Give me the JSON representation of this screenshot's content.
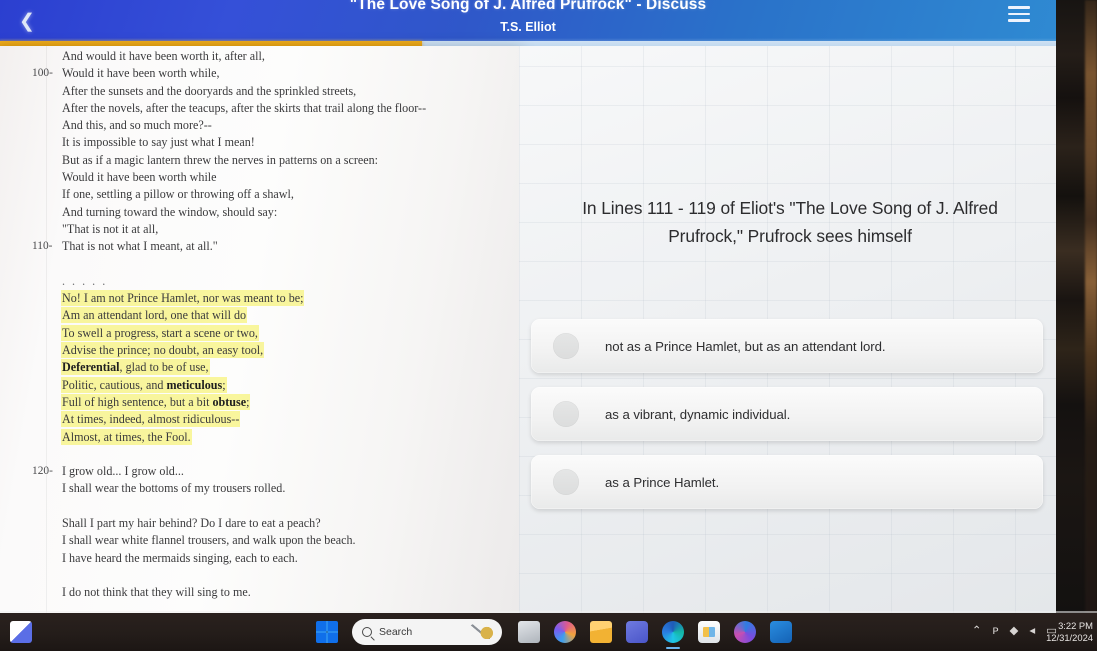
{
  "header": {
    "back_icon": "chevron-left-icon",
    "title": "\"The Love Song of J. Alfred Prufrock\" - Discuss",
    "subtitle": "T.S. Elliot",
    "menu_icon": "hamburger-menu-icon",
    "progress_percent": 40,
    "accent_color": "#e09c10",
    "header_color": "#2f57c9"
  },
  "poem": {
    "lines": [
      {
        "num": "",
        "text": "And would it have been worth it, after all,"
      },
      {
        "num": "100-",
        "text": "Would it have been worth while,"
      },
      {
        "num": "",
        "text": "After the sunsets and the dooryards and the sprinkled streets,"
      },
      {
        "num": "",
        "text": "After the novels, after the teacups, after the skirts that trail along the floor--"
      },
      {
        "num": "",
        "text": "And this, and so much more?--"
      },
      {
        "num": "",
        "text": "It is impossible to say just what I mean!"
      },
      {
        "num": "",
        "text": "But as if a magic lantern threw the nerves in patterns on a screen:"
      },
      {
        "num": "",
        "text": "Would it have been worth while"
      },
      {
        "num": "",
        "text": "If one, settling a pillow or throwing off a shawl,"
      },
      {
        "num": "",
        "text": "And turning toward the window, should say:"
      },
      {
        "num": "",
        "text": "\"That is not it at all,"
      },
      {
        "num": "110-",
        "text": "That is not what I meant, at all.\""
      },
      {
        "num": "",
        "text": "",
        "blank": true
      },
      {
        "num": "",
        "text": ". . . . .",
        "dots": true
      },
      {
        "num": "",
        "text": "No! I am not Prince Hamlet, nor was meant to be;",
        "highlight": true
      },
      {
        "num": "",
        "text": "Am an attendant lord, one that will do",
        "highlight": true
      },
      {
        "num": "",
        "text": "To swell a progress, start a scene or two,",
        "highlight": true
      },
      {
        "num": "",
        "text": "Advise the prince; no doubt, an easy tool,",
        "highlight": true
      },
      {
        "num": "",
        "text": "Deferential, glad to be of use,",
        "highlight": true,
        "bold": "Deferential"
      },
      {
        "num": "",
        "text": "Politic, cautious, and meticulous;",
        "highlight": true,
        "bold": "meticulous"
      },
      {
        "num": "",
        "text": "Full of high sentence, but a bit obtuse;",
        "highlight": true,
        "bold": "obtuse"
      },
      {
        "num": "",
        "text": "At times, indeed, almost ridiculous--",
        "highlight": true
      },
      {
        "num": "",
        "text": "Almost, at times, the Fool.",
        "highlight": true
      },
      {
        "num": "",
        "text": "",
        "blank": true
      },
      {
        "num": "120-",
        "text": "I grow old... I grow old..."
      },
      {
        "num": "",
        "text": "I shall wear the bottoms of my trousers rolled."
      },
      {
        "num": "",
        "text": "",
        "blank": true
      },
      {
        "num": "",
        "text": "Shall I part my hair behind? Do I dare to eat a peach?"
      },
      {
        "num": "",
        "text": "I shall wear white flannel trousers, and walk upon the beach."
      },
      {
        "num": "",
        "text": "I have heard the mermaids singing, each to each."
      },
      {
        "num": "",
        "text": "",
        "blank": true
      },
      {
        "num": "",
        "text": "I do not think that they will sing to me."
      }
    ]
  },
  "quiz": {
    "question": "In Lines 111 - 119 of Eliot's \"The Love Song of J. Alfred Prufrock,\" Prufrock sees himself",
    "options": [
      {
        "label": "not as a Prince Hamlet, but as an attendant lord.",
        "selected": false
      },
      {
        "label": "as a vibrant, dynamic individual.",
        "selected": false
      },
      {
        "label": "as a Prince Hamlet.",
        "selected": false
      }
    ]
  },
  "taskbar": {
    "search_placeholder": "Search",
    "search_icon": "search-icon",
    "start_icon": "windows-start-icon",
    "left_icon": "teams-chat-icon",
    "apps": [
      {
        "name": "taskview-icon",
        "class": "ico-taskview",
        "running": false
      },
      {
        "name": "copilot-icon",
        "class": "ico-copilot",
        "running": false
      },
      {
        "name": "file-explorer-icon",
        "class": "ico-explorer",
        "running": false
      },
      {
        "name": "teams-icon",
        "class": "ico-teams",
        "running": false
      },
      {
        "name": "edge-icon",
        "class": "ico-edge",
        "running": true
      },
      {
        "name": "microsoft-store-icon",
        "class": "ico-store",
        "running": false
      },
      {
        "name": "media-player-icon",
        "class": "ico-mplayer",
        "running": false
      },
      {
        "name": "outlook-icon",
        "class": "ico-outlook",
        "running": false
      }
    ],
    "tray": [
      {
        "name": "show-hidden-icons-icon",
        "glyph": "⌃"
      },
      {
        "name": "network-icon",
        "glyph": "ᴘ"
      },
      {
        "name": "wifi-icon",
        "glyph": "◆"
      },
      {
        "name": "volume-icon",
        "glyph": "◂"
      },
      {
        "name": "battery-icon",
        "glyph": "▭"
      }
    ],
    "time": "3:22 PM",
    "date": "12/31/2024"
  }
}
